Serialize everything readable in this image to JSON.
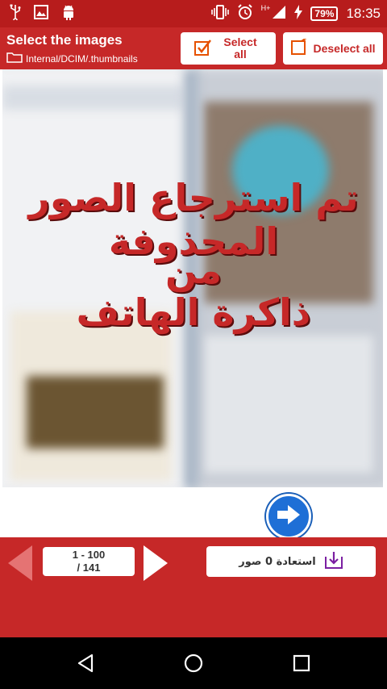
{
  "status_bar": {
    "time": "18:35",
    "battery": "79%",
    "network": "H+",
    "left_icons": [
      "usb-icon",
      "image-icon",
      "android-icon"
    ],
    "right_icons": [
      "vibrate-icon",
      "alarm-icon",
      "signal-icon",
      "charging-icon"
    ]
  },
  "toolbar": {
    "title": "Select the images",
    "path": "Internal/DCIM/.thumbnails",
    "select_all_line1": "Select",
    "select_all_line2": "all",
    "deselect_all": "Deselect all"
  },
  "promo": {
    "line1": "تم استرجاع الصور المحذوفة",
    "line2": "من",
    "line3": "ذاكرة الهاتف"
  },
  "pagination": {
    "range": "1 - 100",
    "total": "/ 141"
  },
  "restore": {
    "label": "استعادة 0 صور"
  },
  "colors": {
    "primary": "#c62828",
    "status": "#b71c1c",
    "fab": "#1e6fd6"
  }
}
